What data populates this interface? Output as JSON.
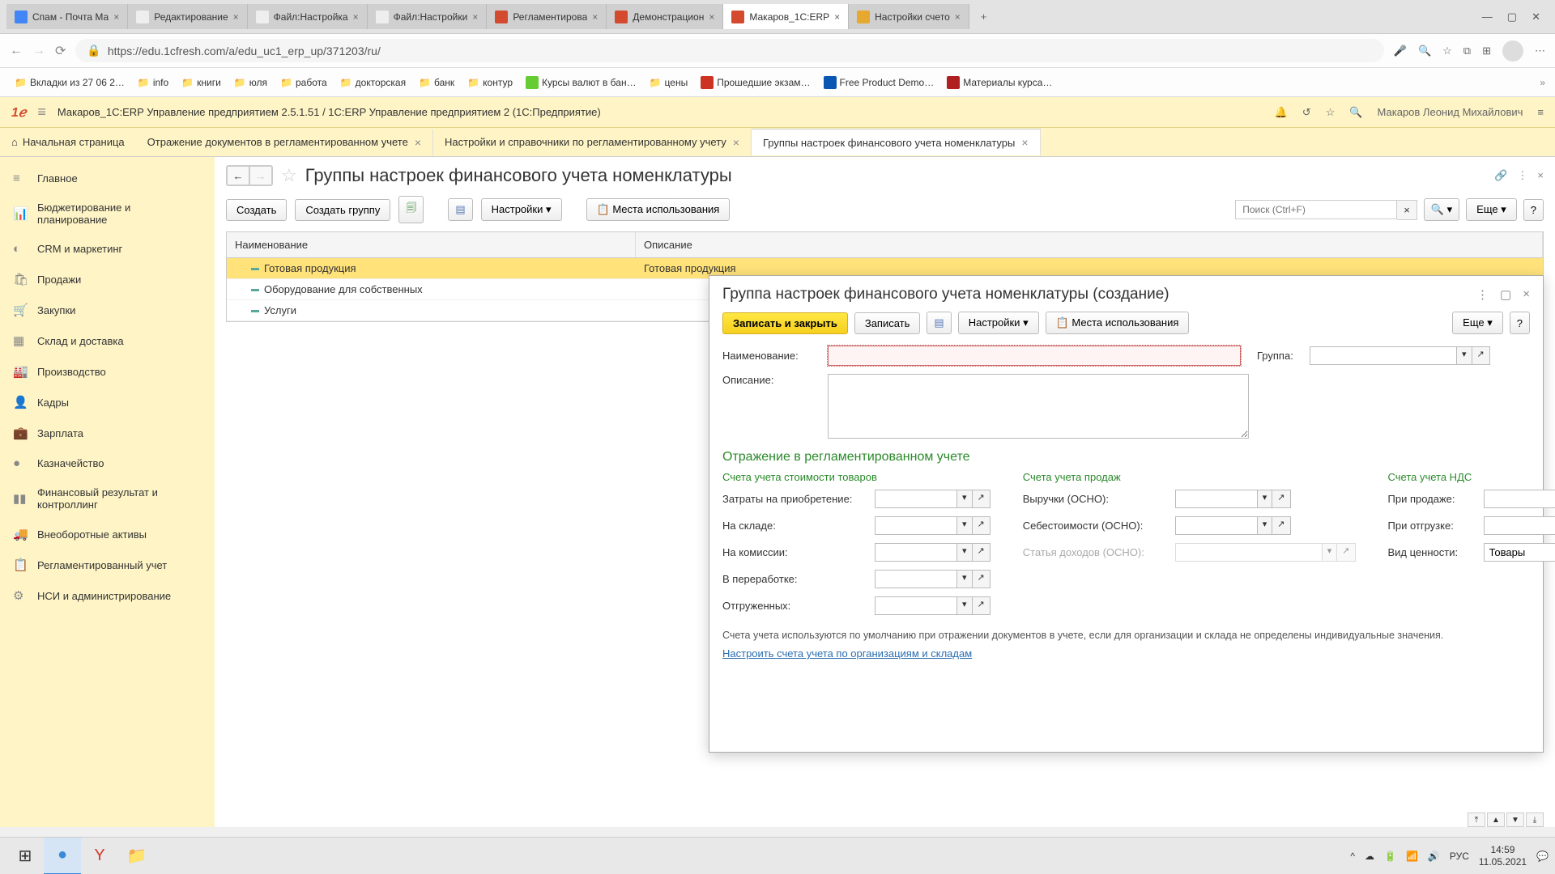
{
  "browser": {
    "tabs": [
      {
        "title": "Спам - Почта Ма"
      },
      {
        "title": "Редактирование"
      },
      {
        "title": "Файл:Настройка"
      },
      {
        "title": "Файл:Настройки"
      },
      {
        "title": "Регламентирова"
      },
      {
        "title": "Демонстрацион"
      },
      {
        "title": "Макаров_1С:ERP",
        "active": true
      },
      {
        "title": "Настройки счето"
      }
    ],
    "url": "https://edu.1cfresh.com/a/edu_uc1_erp_up/371203/ru/",
    "bookmarks": [
      "Вкладки из 27 06 2…",
      "info",
      "книги",
      "юля",
      "работа",
      "докторская",
      "банк",
      "контур",
      "Курсы валют в бан…",
      "цены",
      "Прошедшие экзам…",
      "Free Product Demo…",
      "Материалы курса…"
    ]
  },
  "app": {
    "header_title": "Макаров_1С:ERP Управление предприятием 2.5.1.51 / 1С:ERP Управление предприятием 2   (1С:Предприятие)",
    "user": "Макаров Леонид Михайлович",
    "home": "Начальная страница",
    "tabs": [
      {
        "title": "Отражение документов в регламентированном учете"
      },
      {
        "title": "Настройки и справочники по регламентированному учету"
      },
      {
        "title": "Группы настроек финансового учета номенклатуры",
        "active": true
      }
    ]
  },
  "sidebar": {
    "items": [
      "Главное",
      "Бюджетирование и планирование",
      "CRM и маркетинг",
      "Продажи",
      "Закупки",
      "Склад и доставка",
      "Производство",
      "Кадры",
      "Зарплата",
      "Казначейство",
      "Финансовый результат и контроллинг",
      "Внеоборотные активы",
      "Регламентированный учет",
      "НСИ и администрирование"
    ]
  },
  "page": {
    "title": "Группы настроек финансового учета номенклатуры",
    "toolbar": {
      "create": "Создать",
      "create_group": "Создать группу",
      "settings": "Настройки",
      "usage": "Места использования",
      "search_placeholder": "Поиск (Ctrl+F)",
      "more": "Еще"
    },
    "grid": {
      "col_name": "Наименование",
      "col_desc": "Описание",
      "rows": [
        {
          "name": "Готовая продукция",
          "desc": "Готовая продукция"
        },
        {
          "name": "Оборудование для собственных",
          "desc": ""
        },
        {
          "name": "Услуги",
          "desc": ""
        }
      ]
    }
  },
  "dialog": {
    "title": "Группа настроек финансового учета номенклатуры (создание)",
    "save_close": "Записать и закрыть",
    "save": "Записать",
    "settings": "Настройки",
    "usage": "Места использования",
    "more": "Еще",
    "name_label": "Наименование:",
    "group_label": "Группа:",
    "desc_label": "Описание:",
    "section": "Отражение в регламентированном учете",
    "col1_title": "Счета учета стоимости товаров",
    "col2_title": "Счета учета продаж",
    "col3_title": "Счета учета НДС",
    "f_acquisition": "Затраты на приобретение:",
    "f_warehouse": "На складе:",
    "f_commission": "На комиссии:",
    "f_processing": "В переработке:",
    "f_shipped": "Отгруженных:",
    "f_revenue": "Выручки (ОСНО):",
    "f_cost": "Себестоимости (ОСНО):",
    "f_income": "Статья доходов (ОСНО):",
    "f_on_sale": "При продаже:",
    "f_on_ship": "При отгрузке:",
    "f_value_type": "Вид ценности:",
    "value_type_val": "Товары",
    "hint": "Счета учета используются по умолчанию при отражении документов в учете, если для организации и склада не определены индивидуальные значения.",
    "config_link": "Настроить счета учета по организациям и складам"
  },
  "taskbar": {
    "lang": "РУС",
    "time": "14:59",
    "date": "11.05.2021"
  }
}
